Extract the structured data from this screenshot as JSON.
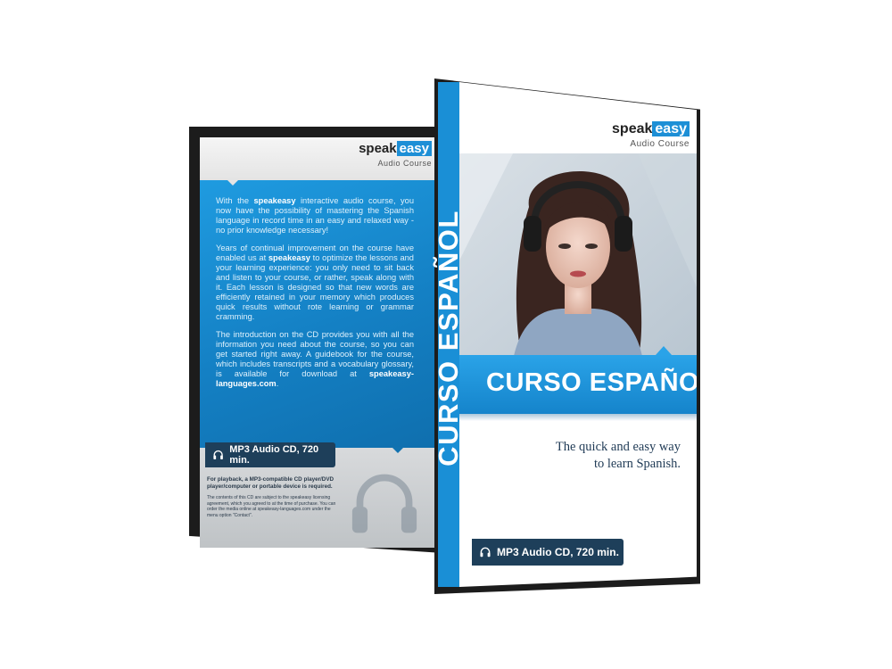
{
  "back": {
    "logo_speak": "speak",
    "logo_easy": "easy",
    "logo_sub": "Audio Course",
    "p1": [
      {
        "t": "With the ",
        "b": false
      },
      {
        "t": "speakeasy",
        "b": true
      },
      {
        "t": " interactive audio course, you now have the possibility of mastering the Spanish language in record time in an easy and relaxed way - no prior knowledge necessary!",
        "b": false
      }
    ],
    "p2": [
      {
        "t": "Years of continual improvement on the course have enabled us at ",
        "b": false
      },
      {
        "t": "speakeasy",
        "b": true
      },
      {
        "t": " to optimize the lessons and your learning experience: you only need to sit back and listen to your course, or rather, speak along with it. Each lesson is designed so that new words are efficiently retained in your memory which produces quick results without rote learning or grammar cramming.",
        "b": false
      }
    ],
    "p3": [
      {
        "t": "The introduction on the CD provides you with all the information you need about the course, so you can get started right away. A guidebook for the course, which includes transcripts and a vocabulary glossary, is available for download at ",
        "b": false
      },
      {
        "t": "speakeasy-languages.com",
        "b": true
      },
      {
        "t": ".",
        "b": false
      }
    ],
    "badge": "MP3 Audio CD, 720 min.",
    "small1": "For playback, a MP3-compatible CD player/DVD player/computer or portable device is required.",
    "small2": "The contents of this CD are subject to the speakeasy licensing agreement, which you agreed to at the time of purchase. You can order the media online at speakeasy-languages.com under the menu option \"Contact\"."
  },
  "front": {
    "spine_title": "CURSO ESPAÑOL",
    "logo_speak": "speak",
    "logo_easy": "easy",
    "logo_sub": "Audio Course",
    "title": "CURSO ESPAÑOL",
    "tagline_line1": "The quick and easy way",
    "tagline_line2": "to learn Spanish.",
    "badge": "MP3 Audio CD, 720 min."
  },
  "colors": {
    "brand_blue": "#1d8fd6",
    "badge_navy": "#1e3f5a",
    "frame": "#1c1c1c"
  }
}
